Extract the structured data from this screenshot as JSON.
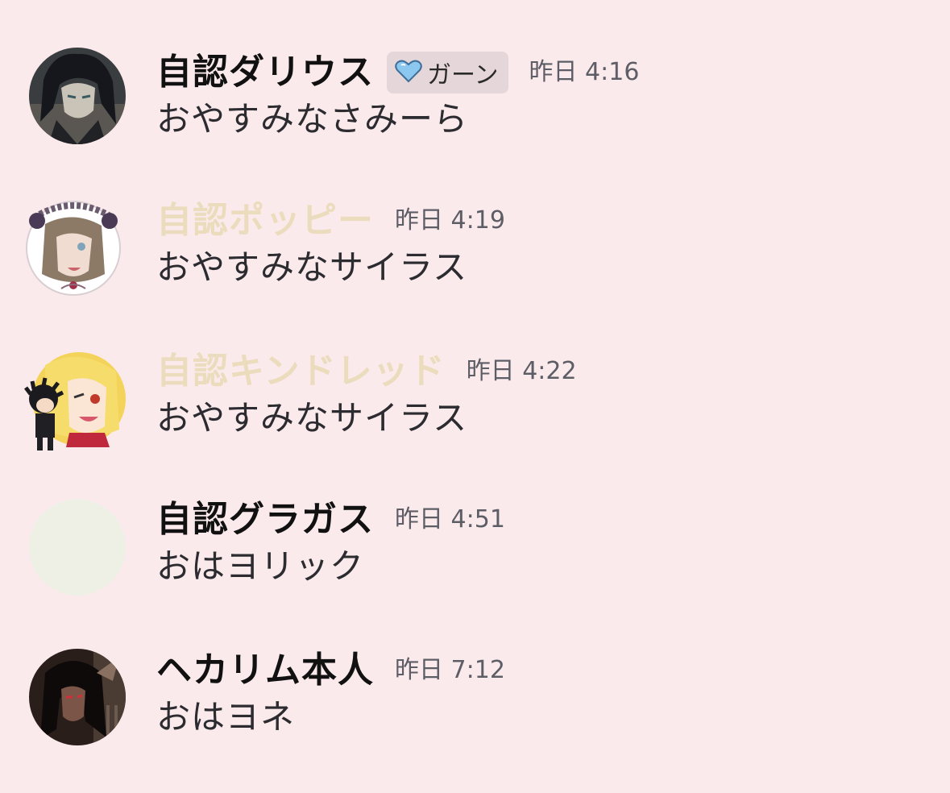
{
  "messages": [
    {
      "author": "自認ダリウス",
      "role_tag": {
        "icon": "blue-heart-icon",
        "label": "ガーン"
      },
      "time": "昨日 4:16",
      "text": "おやすみなさみーら",
      "name_color": "#111111"
    },
    {
      "author": "自認ポッピー",
      "time": "昨日 4:19",
      "text": "おやすみなサイラス",
      "name_color": "#eadcbd"
    },
    {
      "author": "自認キンドレッド",
      "time": "昨日 4:22",
      "text": "おやすみなサイラス",
      "name_color": "#eadcbd"
    },
    {
      "author": "自認グラガス",
      "time": "昨日 4:51",
      "text": "おはヨリック",
      "name_color": "#111111"
    },
    {
      "author": "ヘカリム本人",
      "time": "昨日 7:12",
      "text": "おはヨネ",
      "name_color": "#111111"
    }
  ],
  "colors": {
    "background": "#fbeaec",
    "tag_background": "#e4d6d9",
    "timestamp": "#5d5d66",
    "message_text": "#2b2b30"
  }
}
